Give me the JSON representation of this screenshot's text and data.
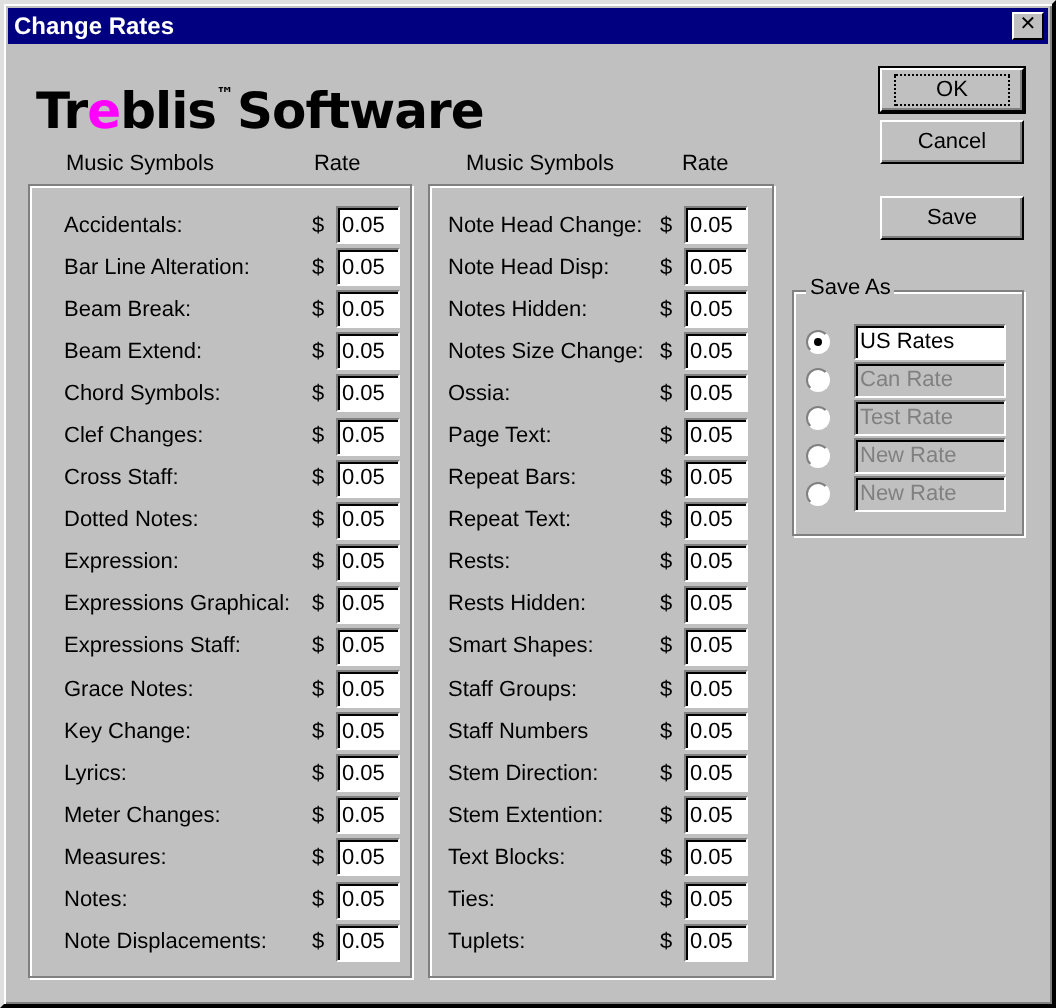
{
  "window": {
    "title": "Change Rates",
    "close": "✕"
  },
  "logo": {
    "segments": [
      {
        "text": "Tr",
        "color": "#000000"
      },
      {
        "text": "e",
        "color": "#ff00ff"
      },
      {
        "text": "blis",
        "color": "#000000"
      }
    ],
    "mark": "™",
    "word": "Software"
  },
  "panels": [
    {
      "header_symbols": "Music Symbols",
      "header_rate": "Rate",
      "rows": [
        {
          "label": "Accidentals:",
          "currency": "$",
          "value": "0.05"
        },
        {
          "label": "Bar Line Alteration:",
          "currency": "$",
          "value": "0.05"
        },
        {
          "label": "Beam Break:",
          "currency": "$",
          "value": "0.05"
        },
        {
          "label": "Beam Extend:",
          "currency": "$",
          "value": "0.05"
        },
        {
          "label": "Chord Symbols:",
          "currency": "$",
          "value": "0.05"
        },
        {
          "label": "Clef Changes:",
          "currency": "$",
          "value": "0.05"
        },
        {
          "label": "Cross Staff:",
          "currency": "$",
          "value": "0.05"
        },
        {
          "label": "Dotted Notes:",
          "currency": "$",
          "value": "0.05"
        },
        {
          "label": "Expression:",
          "currency": "$",
          "value": "0.05"
        },
        {
          "label": "Expressions Graphical:",
          "currency": "$",
          "value": "0.05"
        },
        {
          "label": "Expressions Staff:",
          "currency": "$",
          "value": "0.05"
        },
        {
          "label": "Grace Notes:",
          "currency": "$",
          "value": "0.05"
        },
        {
          "label": "Key Change:",
          "currency": "$",
          "value": "0.05"
        },
        {
          "label": "Lyrics:",
          "currency": "$",
          "value": "0.05"
        },
        {
          "label": "Meter Changes:",
          "currency": "$",
          "value": "0.05"
        },
        {
          "label": "Measures:",
          "currency": "$",
          "value": "0.05"
        },
        {
          "label": "Notes:",
          "currency": "$",
          "value": "0.05"
        },
        {
          "label": "Note Displacements:",
          "currency": "$",
          "value": "0.05"
        }
      ]
    },
    {
      "header_symbols": "Music Symbols",
      "header_rate": "Rate",
      "rows": [
        {
          "label": "Note Head Change:",
          "currency": "$",
          "value": "0.05"
        },
        {
          "label": "Note Head Disp:",
          "currency": "$",
          "value": "0.05"
        },
        {
          "label": "Notes Hidden:",
          "currency": "$",
          "value": "0.05"
        },
        {
          "label": "Notes Size Change:",
          "currency": "$",
          "value": "0.05"
        },
        {
          "label": "Ossia:",
          "currency": "$",
          "value": "0.05"
        },
        {
          "label": "Page Text:",
          "currency": "$",
          "value": "0.05"
        },
        {
          "label": "Repeat Bars:",
          "currency": "$",
          "value": "0.05"
        },
        {
          "label": "Repeat Text:",
          "currency": "$",
          "value": "0.05"
        },
        {
          "label": "Rests:",
          "currency": "$",
          "value": "0.05"
        },
        {
          "label": "Rests Hidden:",
          "currency": "$",
          "value": "0.05"
        },
        {
          "label": "Smart Shapes:",
          "currency": "$",
          "value": "0.05"
        },
        {
          "label": "Staff Groups:",
          "currency": "$",
          "value": "0.05"
        },
        {
          "label": "Staff Numbers",
          "currency": "$",
          "value": "0.05"
        },
        {
          "label": "Stem Direction:",
          "currency": "$",
          "value": "0.05"
        },
        {
          "label": "Stem Extention:",
          "currency": "$",
          "value": "0.05"
        },
        {
          "label": "Text Blocks:",
          "currency": "$",
          "value": "0.05"
        },
        {
          "label": "Ties:",
          "currency": "$",
          "value": "0.05"
        },
        {
          "label": "Tuplets:",
          "currency": "$",
          "value": "0.05"
        }
      ]
    }
  ],
  "buttons": [
    {
      "label": "OK",
      "default": true
    },
    {
      "label": "Cancel",
      "default": false
    }
  ],
  "save_button": "Save",
  "save_as": {
    "title": "Save As",
    "options": [
      {
        "value": "US Rates",
        "selected": true,
        "disabled": false
      },
      {
        "value": "Can Rate",
        "selected": false,
        "disabled": true
      },
      {
        "value": "Test Rate",
        "selected": false,
        "disabled": true
      },
      {
        "value": "New Rate",
        "selected": false,
        "disabled": true
      },
      {
        "value": "New Rate",
        "selected": false,
        "disabled": true
      }
    ]
  }
}
